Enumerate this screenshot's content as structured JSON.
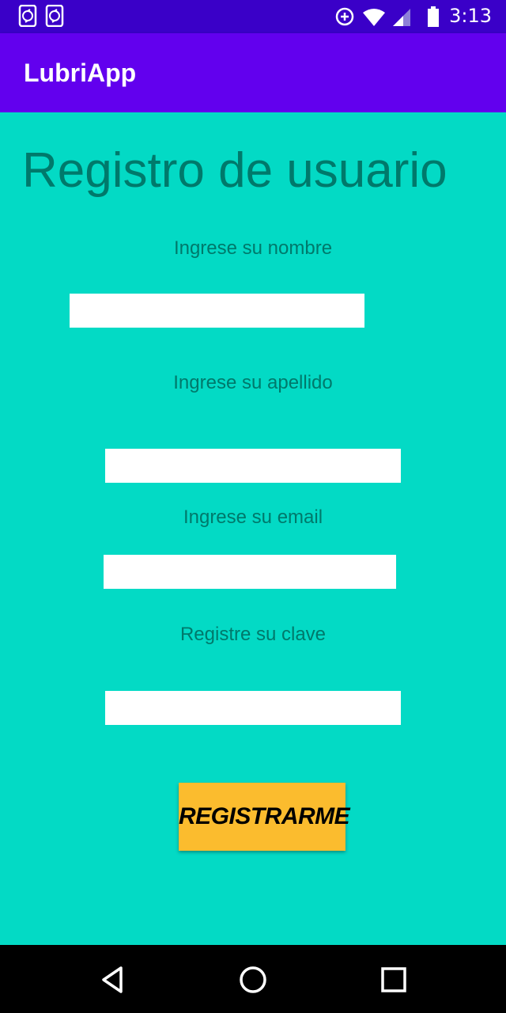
{
  "status_bar": {
    "time": "3:13",
    "icons": [
      "phone-sync-icon",
      "phone-sync-icon",
      "data-saver-icon",
      "wifi-icon",
      "cell-signal-icon",
      "battery-icon"
    ]
  },
  "app_bar": {
    "title": "LubriApp"
  },
  "form": {
    "heading": "Registro de usuario",
    "name_label": "Ingrese su nombre",
    "lastname_label": "Ingrese su apellido",
    "email_label": "Ingrese su email",
    "password_label": "Registre su clave",
    "name_value": "",
    "lastname_value": "",
    "email_value": "",
    "password_value": "",
    "submit_label": "REGISTRARME"
  },
  "nav_bar": {
    "icons": [
      "back-icon",
      "home-icon",
      "recents-icon"
    ]
  },
  "colors": {
    "status_bar": "#3a00c8",
    "app_bar": "#6200ee",
    "background": "#03dac5",
    "text": "#00796b",
    "button": "#fbbc2e"
  }
}
